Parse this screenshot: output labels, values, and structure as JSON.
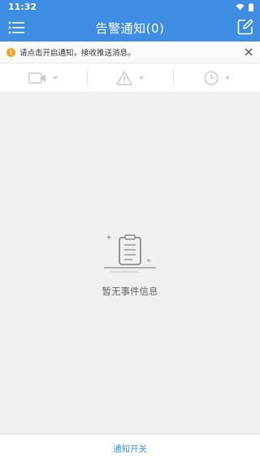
{
  "status_bar": {
    "time": "11:32"
  },
  "header": {
    "title": "告警通知(0)"
  },
  "notice": {
    "text": "请点击开启通知，接收推送消息。"
  },
  "filters": [
    {
      "icon": "camera-icon"
    },
    {
      "icon": "warning-icon"
    },
    {
      "icon": "clock-icon"
    }
  ],
  "empty_state": {
    "text": "暂无事件信息"
  },
  "bottom_bar": {
    "label": "通知开关"
  },
  "colors": {
    "accent": "#3f8de3",
    "warning": "#f5a623"
  }
}
